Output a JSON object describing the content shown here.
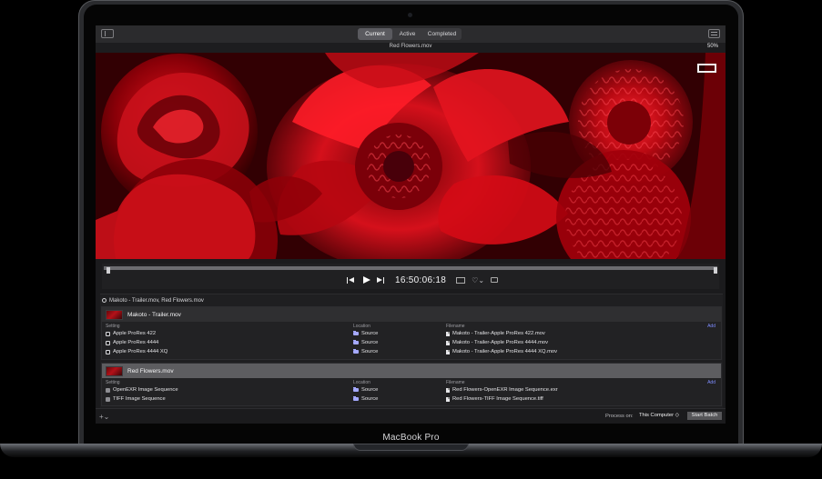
{
  "device": {
    "brand": "MacBook Pro"
  },
  "toolbar": {
    "tabs": [
      {
        "label": "Current"
      },
      {
        "label": "Active"
      },
      {
        "label": "Completed"
      }
    ]
  },
  "viewer": {
    "filename": "Red Flowers.mov",
    "zoom": "50%",
    "timecode": "16:50:06:18"
  },
  "batch": {
    "title": "Makoto - Trailer.mov, Red Flowers.mov",
    "jobs": [
      {
        "name": "Makoto - Trailer.mov",
        "headers": {
          "setting": "Setting",
          "location": "Location",
          "filename": "Filename",
          "add": "Add"
        },
        "rows": [
          {
            "setting": "Apple ProRes 422",
            "location": "Source",
            "filename": "Makoto - Trailer-Apple ProRes 422.mov"
          },
          {
            "setting": "Apple ProRes 4444",
            "location": "Source",
            "filename": "Makoto - Trailer-Apple ProRes 4444.mov"
          },
          {
            "setting": "Apple ProRes 4444 XQ",
            "location": "Source",
            "filename": "Makoto - Trailer-Apple ProRes 4444 XQ.mov"
          }
        ]
      },
      {
        "name": "Red Flowers.mov",
        "headers": {
          "setting": "Setting",
          "location": "Location",
          "filename": "Filename",
          "add": "Add"
        },
        "rows": [
          {
            "setting": "OpenEXR Image Sequence",
            "location": "Source",
            "filename": "Red Flowers-OpenEXR Image Sequence.exr"
          },
          {
            "setting": "TIFF Image Sequence",
            "location": "Source",
            "filename": "Red Flowers-TIFF Image Sequence.tiff"
          }
        ]
      }
    ]
  },
  "footer": {
    "add_control": "+⌄",
    "process_on_label": "Process on:",
    "computer": "This Computer ◇",
    "start_batch": "Start Batch"
  },
  "colors": {
    "accent": "#7f8dff",
    "flower_red": "#b50d16",
    "screen_bg": "#1b1b1d"
  }
}
